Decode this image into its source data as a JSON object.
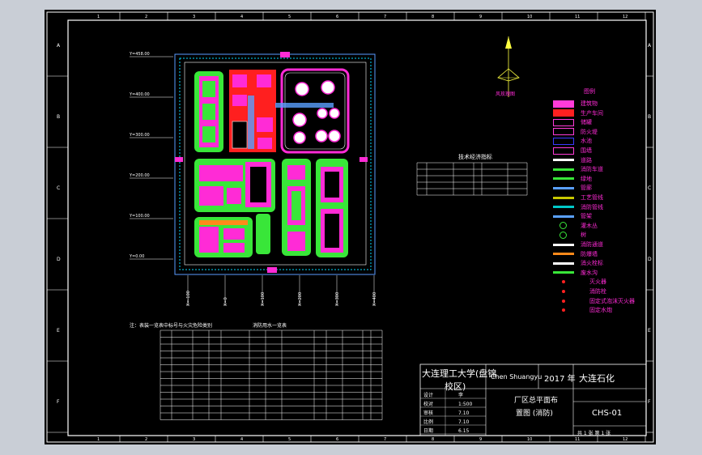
{
  "drawing": {
    "border_letters": [
      "A",
      "B",
      "C",
      "D",
      "E",
      "F"
    ],
    "border_numbers": [
      "1",
      "2",
      "3",
      "4",
      "5",
      "6",
      "7",
      "8",
      "9",
      "10",
      "11",
      "12"
    ],
    "title_block": {
      "school": "大连理工大学(盘锦",
      "school2": "校区)",
      "designer": "Chen Shuangyu",
      "year": "2017 年",
      "company": "大连石化",
      "drawing_title1": "厂区总平面布",
      "drawing_title2": "置图 (消防)",
      "drawing_no": "CHS-01",
      "sheet_info": "共 1 张   第 1 张",
      "rows": [
        "设计",
        "校对",
        "审核",
        "比例",
        "日期"
      ],
      "row_values": [
        "李",
        "1:500",
        "7.10",
        "7.10",
        "6.15"
      ]
    },
    "table1_title": "技术经济指标",
    "table2_title": "消防用水一览表",
    "table2_caption": "注：表装一览表中标号与火灾危险类别",
    "legend_title": "图例",
    "legend_items": [
      {
        "label": "建筑物",
        "icon": "building-icon",
        "color": "#ff3bd8"
      },
      {
        "label": "生产车间",
        "icon": "workshop-icon",
        "color": "#ff2020"
      },
      {
        "label": "储罐",
        "icon": "tank-icon",
        "color": "#ff3bd8"
      },
      {
        "label": "防火堤",
        "icon": "firewall-icon",
        "color": "#ff3bd8"
      },
      {
        "label": "水池",
        "icon": "pool-icon",
        "color": "#3a3aff"
      },
      {
        "label": "围墙",
        "icon": "wall-icon",
        "color": "#ff3bd8"
      },
      {
        "label": "道路",
        "icon": "road-icon",
        "color": "#ffffff"
      },
      {
        "label": "消防车道",
        "icon": "fire-lane-icon",
        "color": "#39e639"
      },
      {
        "label": "绿地",
        "icon": "greenbelt-icon",
        "color": "#39e639"
      },
      {
        "label": "管廊",
        "icon": "pipe-rack-icon",
        "color": "#5aa0ff"
      },
      {
        "label": "工艺管线",
        "icon": "pipeline-icon",
        "color": "#c8c800"
      },
      {
        "label": "消防管线",
        "icon": "fire-pipe-icon",
        "color": "#00c8c8"
      },
      {
        "label": "管架",
        "icon": "pipe-support-icon",
        "color": "#5aa0ff"
      },
      {
        "label": "灌木丛",
        "icon": "shrub-icon",
        "color": "#39e639"
      },
      {
        "label": "树",
        "icon": "tree-icon",
        "color": "#39e639"
      },
      {
        "label": "消防通道",
        "icon": "fire-passage-icon",
        "color": "#ffffff"
      },
      {
        "label": "防爆墙",
        "icon": "blast-wall-icon",
        "color": "#ff8a1a"
      },
      {
        "label": "消火栓标",
        "icon": "hydrant-flag-icon",
        "color": "#ffffff"
      },
      {
        "label": "废水沟",
        "icon": "drain-icon",
        "color": "#39e639"
      },
      {
        "label": "灭火器",
        "icon": "extinguisher-icon",
        "color": "#ff2020"
      },
      {
        "label": "消防栓",
        "icon": "hydrant-icon",
        "color": "#ff2020"
      },
      {
        "label": "固定式泡沫灭火器",
        "icon": "foam-icon",
        "color": "#ff2020"
      },
      {
        "label": "固定水炮",
        "icon": "water-cannon-icon",
        "color": "#ff2020"
      }
    ],
    "coords_left": [
      "Y=458.00",
      "Y=400.00",
      "Y=300.00",
      "Y=200.00",
      "Y=100.00",
      "Y=0.00"
    ],
    "coords_top": [
      "X=-100",
      "X=0",
      "X=100",
      "X=200",
      "X=300",
      "X=400"
    ],
    "colors": {
      "background": "#000000",
      "border": "#ffffff",
      "building": "#ff2bd6",
      "green": "#39e639",
      "red": "#ff1f1f",
      "cyan": "#00d8ff"
    }
  }
}
